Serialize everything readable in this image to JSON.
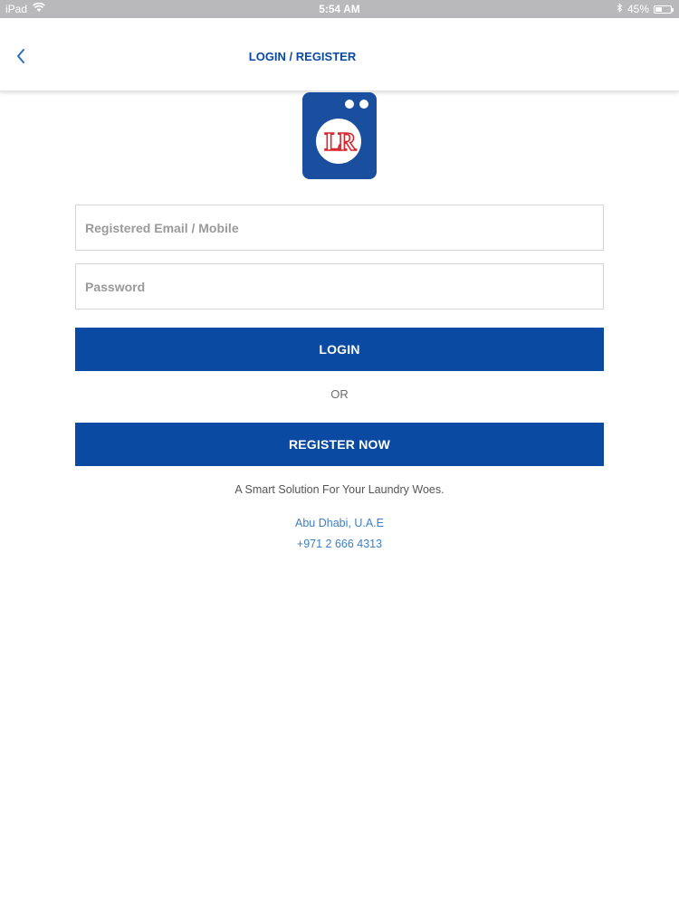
{
  "status_bar": {
    "device": "iPad",
    "time": "5:54 AM",
    "battery": "45%",
    "battery_level": 0.45
  },
  "nav": {
    "title": "LOGIN / REGISTER",
    "back_icon": "chevron-left-icon"
  },
  "logo": {
    "icon": "washing-machine-logo",
    "letters": "LR",
    "colors": {
      "background": "#1a4fa0",
      "circle": "#ffffff",
      "letters": "#d9262c"
    }
  },
  "form": {
    "email_placeholder": "Registered Email / Mobile",
    "email_value": "",
    "password_placeholder": "Password",
    "password_value": "",
    "login_label": "LOGIN",
    "or_label": "OR",
    "register_label": "REGISTER NOW"
  },
  "footer": {
    "tagline": "A Smart Solution For Your Laundry Woes.",
    "location": "Abu Dhabi, U.A.E",
    "phone": "+971 2 666 4313"
  },
  "colors": {
    "primary": "#0b4aa2",
    "link": "#3d7fc4",
    "status_bar": "#b9b9bc"
  }
}
